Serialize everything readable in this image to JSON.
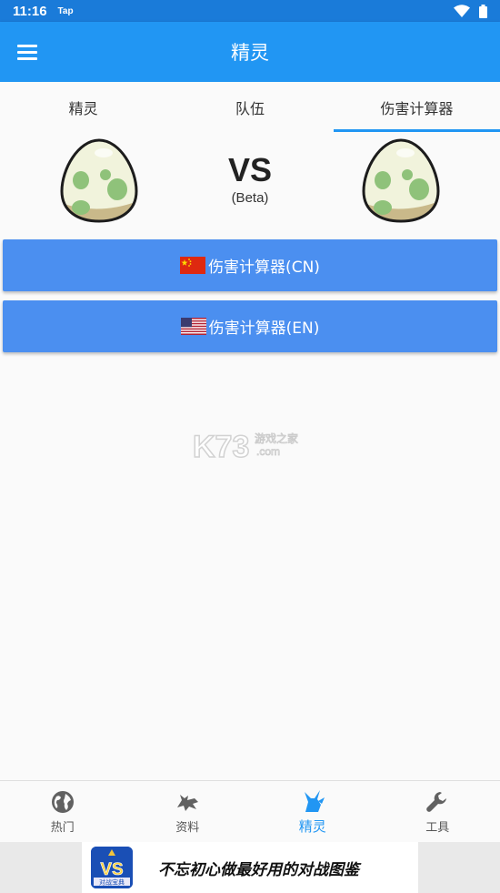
{
  "status_bar": {
    "time": "11:16",
    "tag": "Tap"
  },
  "app_bar": {
    "title": "精灵",
    "menu_icon": "hamburger-menu-icon"
  },
  "tabs": [
    {
      "label": "精灵",
      "active": false
    },
    {
      "label": "队伍",
      "active": false
    },
    {
      "label": "伤害计算器",
      "active": true
    }
  ],
  "battle": {
    "vs": "VS",
    "beta": "(Beta)",
    "left_icon": "pokemon-egg-icon",
    "right_icon": "pokemon-egg-icon"
  },
  "buttons": {
    "cn_label": "伤害计算器(CN)",
    "en_label": "伤害计算器(EN)",
    "cn_flag": "china-flag-icon",
    "en_flag": "usa-flag-icon"
  },
  "watermark": {
    "logo": "K73",
    "text1": "游戏之家",
    "text2": ".com"
  },
  "bottom_nav": [
    {
      "label": "热门",
      "icon": "globe-icon",
      "active": false
    },
    {
      "label": "资料",
      "icon": "dragon-icon",
      "active": false
    },
    {
      "label": "精灵",
      "icon": "pikachu-icon",
      "active": true
    },
    {
      "label": "工具",
      "icon": "wrench-icon",
      "active": false
    }
  ],
  "ad_banner": {
    "text": "不忘初心做最好用的对战图鉴",
    "logo_text": "VS",
    "logo_sub": "对战宝典"
  },
  "colors": {
    "primary": "#2196f3",
    "status_bar": "#1a7bd9",
    "button": "#4b8ff0"
  }
}
